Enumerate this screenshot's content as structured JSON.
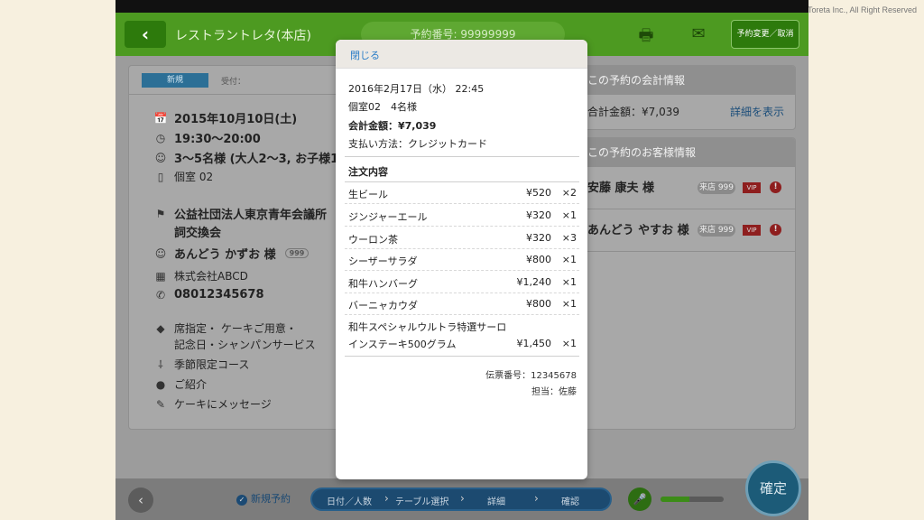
{
  "copyright": "Toreta Inc., All Right Reserved",
  "header": {
    "shop_name": "レストラントレタ(本店)",
    "reservation_number": "予約番号: 99999999",
    "change_cancel": "予約変更／取消"
  },
  "left": {
    "badge_new": "新規",
    "uketsuke": "受付：",
    "date": "2015年10月10日(土)",
    "time": "19:30〜20:00",
    "party": "3〜5名様 (大人2〜3, お子様1〜2)",
    "room": "個室 02",
    "org_line1": "公益社団法人東京青年会議所",
    "org_line2": "詞交換会",
    "guest": "あんどう かずお 様",
    "guest_badge": "999",
    "company": "株式会社ABCD",
    "phone": "08012345678",
    "requests_line1": "席指定・ ケーキご用意・",
    "requests_line2": "記念日・シャンパンサービス",
    "course": "季節限定コース",
    "referral": "ご紹介",
    "cake_message": "ケーキにメッセージ"
  },
  "right": {
    "accounting_title": "この予約の会計情報",
    "total": "合計金額：¥7,039",
    "detail_link": "詳細を表示",
    "customer_title": "この予約のお客様情報",
    "customers": [
      {
        "name": "安藤 康夫 様",
        "badge": "来店 999",
        "vip": "VIP"
      },
      {
        "name": "あんどう やすお 様",
        "badge": "来店 999",
        "vip": "VIP"
      }
    ]
  },
  "modal": {
    "close": "閉じる",
    "datetime": "2016年2月17日（水） 22:45",
    "room_people": "個室02　4名様",
    "total": "会計金額：¥7,039",
    "payment": "支払い方法：クレジットカード",
    "order_title": "注文内容",
    "items": [
      {
        "name": "生ビール",
        "price": "¥520",
        "qty": "×2"
      },
      {
        "name": "ジンジャーエール",
        "price": "¥320",
        "qty": "×1"
      },
      {
        "name": "ウーロン茶",
        "price": "¥320",
        "qty": "×3"
      },
      {
        "name": "シーザーサラダ",
        "price": "¥800",
        "qty": "×1"
      },
      {
        "name": "和牛ハンバーグ",
        "price": "¥1,240",
        "qty": "×1"
      },
      {
        "name": "バーニャカウダ",
        "price": "¥800",
        "qty": "×1"
      }
    ],
    "long_item": {
      "line1": "和牛スペシャルウルトラ特選サーロ",
      "line2": "インステーキ500グラム",
      "price": "¥1,450",
      "qty": "×1"
    },
    "slip": "伝票番号：12345678",
    "staff": "担当：佐藤"
  },
  "bottom": {
    "new_reservation": "新規予約",
    "steps": [
      "日付／人数",
      "テーブル選択",
      "詳細",
      "確認"
    ],
    "confirm": "確定",
    "mic_level": 0.45
  }
}
